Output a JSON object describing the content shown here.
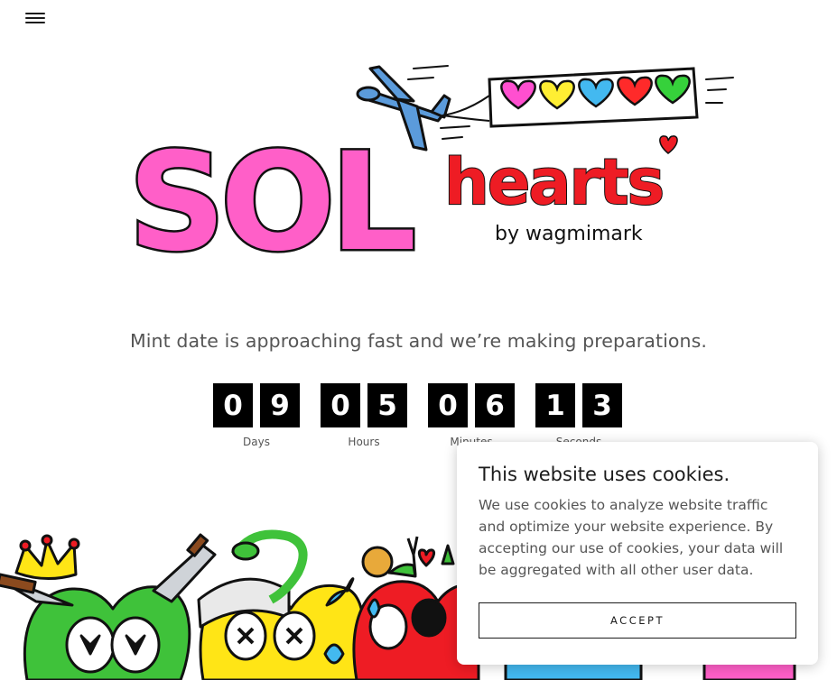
{
  "header": {
    "menu_icon": "hamburger-menu-icon"
  },
  "logo": {
    "brand_main": "SOL",
    "brand_sub": "hearts",
    "byline": "by wagmimark",
    "colors": {
      "sol_pink": "#ff5fc8",
      "hearts_red": "#ee1c24",
      "plane_blue": "#5b9bdb"
    },
    "banner_hearts": [
      "#ff4fd0",
      "#ffee33",
      "#43b9f0",
      "#ff2a2a",
      "#36d13b"
    ]
  },
  "hero": {
    "tagline": "Mint date is approaching fast and we’re making preparations."
  },
  "countdown": {
    "days": {
      "digits": [
        "0",
        "9"
      ],
      "label": "Days"
    },
    "hours": {
      "digits": [
        "0",
        "5"
      ],
      "label": "Hours"
    },
    "minutes": {
      "digits": [
        "0",
        "6"
      ],
      "label": "Minutes"
    },
    "seconds": {
      "digits": [
        "1",
        "3"
      ],
      "label": "Seconds"
    }
  },
  "cookie_banner": {
    "title": "This website uses cookies.",
    "text": "We use cookies to analyze website traffic and optimize your website experience. By accepting our use of cookies, your data will be aggregated with all other user data.",
    "accept_label": "ACCEPT"
  },
  "art": {
    "colors": {
      "green": "#3fc23a",
      "yellow": "#ffe516",
      "red": "#ee1c24",
      "pink": "#ff5fc8",
      "blue": "#43b9f0"
    }
  }
}
